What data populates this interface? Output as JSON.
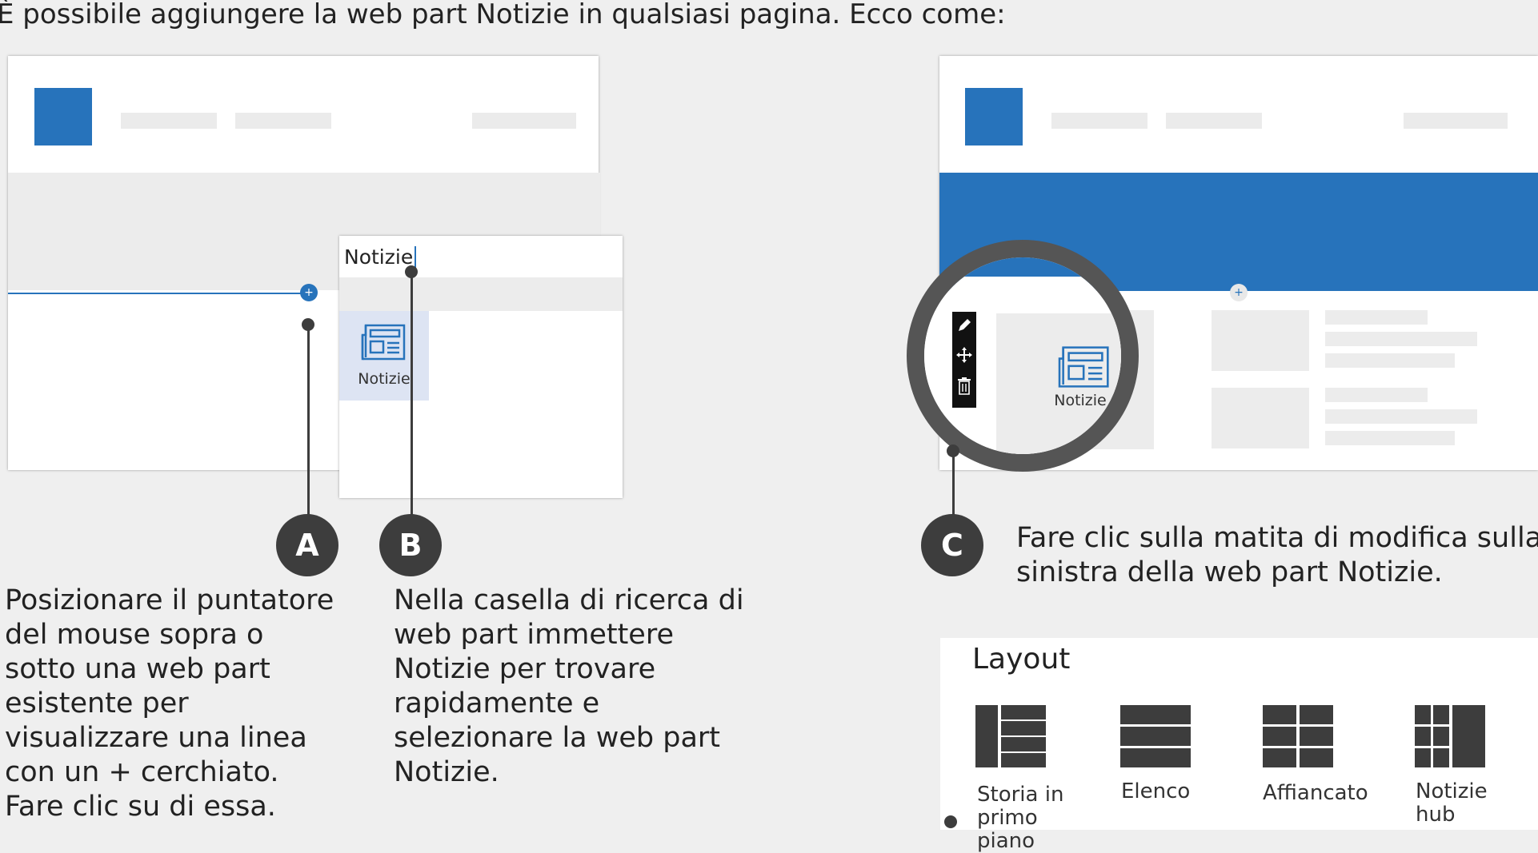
{
  "intro": "È possibile aggiungere la web part Notizie in qualsiasi pagina. Ecco come:",
  "search": {
    "query": "Notizie",
    "result_label": "Notizie"
  },
  "magnifier": {
    "webpart_label": "Notizie"
  },
  "steps": [
    {
      "badge": "A",
      "text": "Posizionare il puntatore del mouse sopra o sotto una web part esistente per visualizzare una linea con un + cerchiato. Fare clic su di essa."
    },
    {
      "badge": "B",
      "text": "Nella casella di ricerca di web part immettere Notizie per trovare rapidamente e selezionare la web part Notizie."
    },
    {
      "badge": "C",
      "text": "Fare clic sulla matita di modifica sulla sinistra della web part Notizie."
    }
  ],
  "layout_panel": {
    "title": "Layout",
    "options": [
      "Storia in primo piano",
      "Elenco",
      "Affiancato",
      "Notizie hub"
    ]
  },
  "colors": {
    "accent": "#2773bb",
    "dark": "#3d3d3d"
  }
}
